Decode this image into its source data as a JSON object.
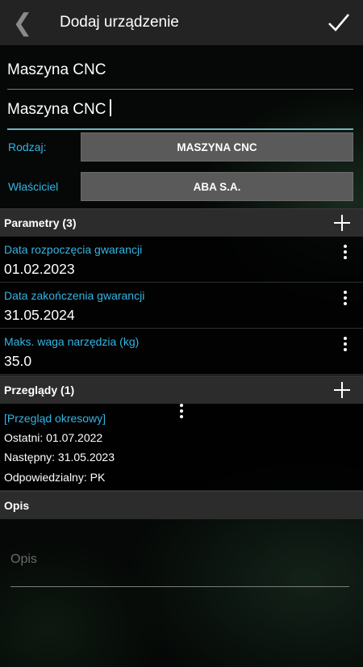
{
  "header": {
    "title": "Dodaj urządzenie"
  },
  "form": {
    "name_value": "Maszyna CNC",
    "name2_value": "Maszyna CNC",
    "type_label": "Rodzaj:",
    "type_button": "MASZYNA CNC",
    "owner_label": "Właściciel",
    "owner_button": "ABA S.A."
  },
  "parameters": {
    "title": "Parametry (3)",
    "items": [
      {
        "label": "Data rozpoczęcia gwarancji",
        "value": "01.02.2023"
      },
      {
        "label": "Data zakończenia gwarancji",
        "value": "31.05.2024"
      },
      {
        "label": "Maks. waga narzędzia (kg)",
        "value": "35.0"
      }
    ]
  },
  "inspections": {
    "title": "Przeglądy (1)",
    "items": [
      {
        "name": "[Przegląd okresowy]",
        "last": "Ostatni: 01.07.2022",
        "next": "Następny: 31.05.2023",
        "responsible": "Odpowiedzialny: PK"
      }
    ]
  },
  "description": {
    "title": "Opis",
    "placeholder": "Opis"
  },
  "colors": {
    "accent": "#33b5e5",
    "active_underline": "#6fb5bd",
    "button_bg": "#5a5a5a",
    "toolbar_bg": "#232323"
  }
}
